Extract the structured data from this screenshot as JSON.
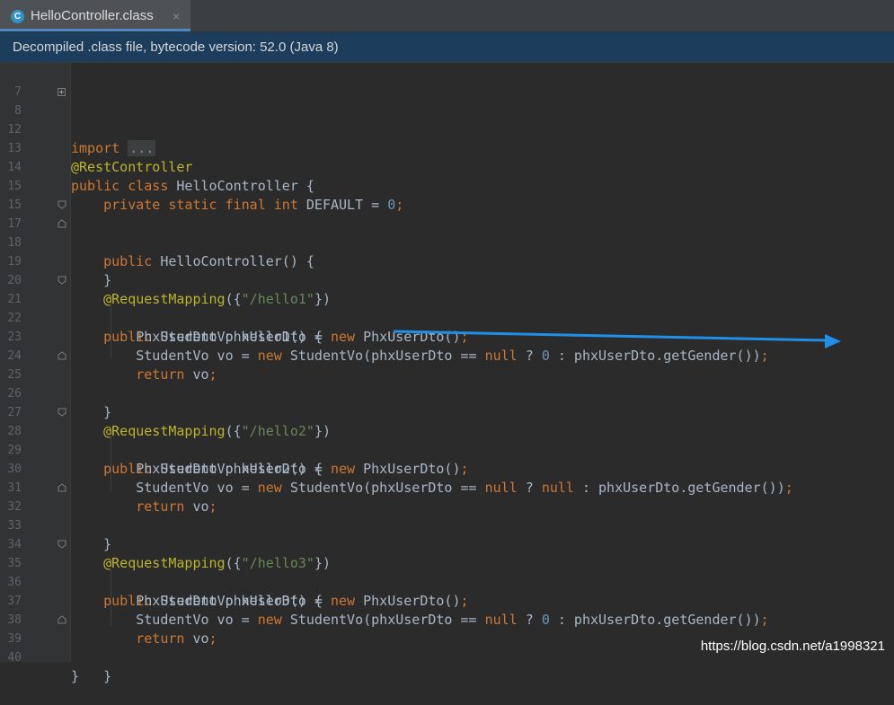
{
  "tab": {
    "icon": "class-c-icon",
    "icon_letter": "C",
    "title": "HelloController.class",
    "close": "×"
  },
  "banner": {
    "text": "Decompiled .class file, bytecode version: 52.0 (Java 8)"
  },
  "editor": {
    "lines": {
      "l7": {
        "num": "7"
      },
      "l8": {
        "num": "8",
        "kw": "import",
        "folded": "..."
      },
      "l12": {
        "num": "12"
      },
      "l13": {
        "num": "13",
        "annotation": "@RestController"
      },
      "l14": {
        "num": "14",
        "kw1": "public",
        "kw2": "class",
        "name": "HelloController",
        "rest": " {"
      },
      "l15": {
        "num": "15",
        "kw": "private static final int",
        "name": " DEFAULT = ",
        "value": "0",
        "semi": ";"
      },
      "l16": {
        "num": "15"
      },
      "l17": {
        "num": "17",
        "kw": "public",
        "rest": " HelloController() {"
      },
      "l18": {
        "num": "18",
        "rest": "}"
      },
      "l19": {
        "num": "19"
      },
      "l20": {
        "num": "20",
        "annotation": "@RequestMapping",
        "open": "({",
        "str": "\"/hello1\"",
        "close": "})"
      },
      "l21": {
        "num": "21",
        "kw": "public",
        "rest": " StudentVo hello1() {"
      },
      "l22": {
        "num": "22",
        "a": "PhxUserDto phxUserDto = ",
        "kw": "new",
        "b": " PhxUserDto()",
        "semi": ";"
      },
      "l23": {
        "num": "23",
        "a": "StudentVo vo = ",
        "kw": "new",
        "b": " StudentVo(phxUserDto == ",
        "kw2": "null",
        "c": " ? ",
        "num_val": "0",
        "d": " : phxUserDto.getGender())",
        "semi": ";"
      },
      "l24": {
        "num": "24",
        "kw": "return",
        "rest": " vo",
        "semi": ";"
      },
      "l25": {
        "num": "25",
        "rest": "}"
      },
      "l26": {
        "num": "26"
      },
      "l27": {
        "num": "27",
        "annotation": "@RequestMapping",
        "open": "({",
        "str": "\"/hello2\"",
        "close": "})"
      },
      "l28": {
        "num": "28",
        "kw": "public",
        "rest": " StudentVo hello2() {"
      },
      "l29": {
        "num": "29",
        "a": "PhxUserDto phxUserDto = ",
        "kw": "new",
        "b": " PhxUserDto()",
        "semi": ";"
      },
      "l30": {
        "num": "30",
        "a": "StudentVo vo = ",
        "kw": "new",
        "b": " StudentVo(phxUserDto == ",
        "kw2": "null",
        "c": " ? ",
        "kw3": "null",
        "d": " : phxUserDto.getGender())",
        "semi": ";"
      },
      "l31": {
        "num": "31",
        "kw": "return",
        "rest": " vo",
        "semi": ";"
      },
      "l32": {
        "num": "32",
        "rest": "}"
      },
      "l33": {
        "num": "33"
      },
      "l34": {
        "num": "34",
        "annotation": "@RequestMapping",
        "open": "({",
        "str": "\"/hello3\"",
        "close": "})"
      },
      "l35": {
        "num": "35",
        "kw": "public",
        "rest": " StudentVo hello3() {"
      },
      "l36": {
        "num": "36",
        "a": "PhxUserDto phxUserDto = ",
        "kw": "new",
        "b": " PhxUserDto()",
        "semi": ";"
      },
      "l37": {
        "num": "37",
        "a": "StudentVo vo = ",
        "kw": "new",
        "b": " StudentVo(phxUserDto == ",
        "kw2": "null",
        "c": " ? ",
        "num_val": "0",
        "d": " : phxUserDto.getGender())",
        "semi": ";"
      },
      "l38": {
        "num": "38",
        "kw": "return",
        "rest": " vo",
        "semi": ";"
      },
      "l39": {
        "num": "39",
        "rest": "}"
      },
      "l40": {
        "num": "40",
        "rest": "}"
      }
    }
  },
  "annotation_arrow": {
    "color": "#1f8fe8"
  },
  "watermark": {
    "text": "https://blog.csdn.net/a1998321"
  },
  "colors": {
    "keyword": "#cc7832",
    "annotation": "#bbb529",
    "string": "#6a8759",
    "number": "#6897bb",
    "text": "#a9b7c6",
    "background": "#2b2b2b"
  }
}
